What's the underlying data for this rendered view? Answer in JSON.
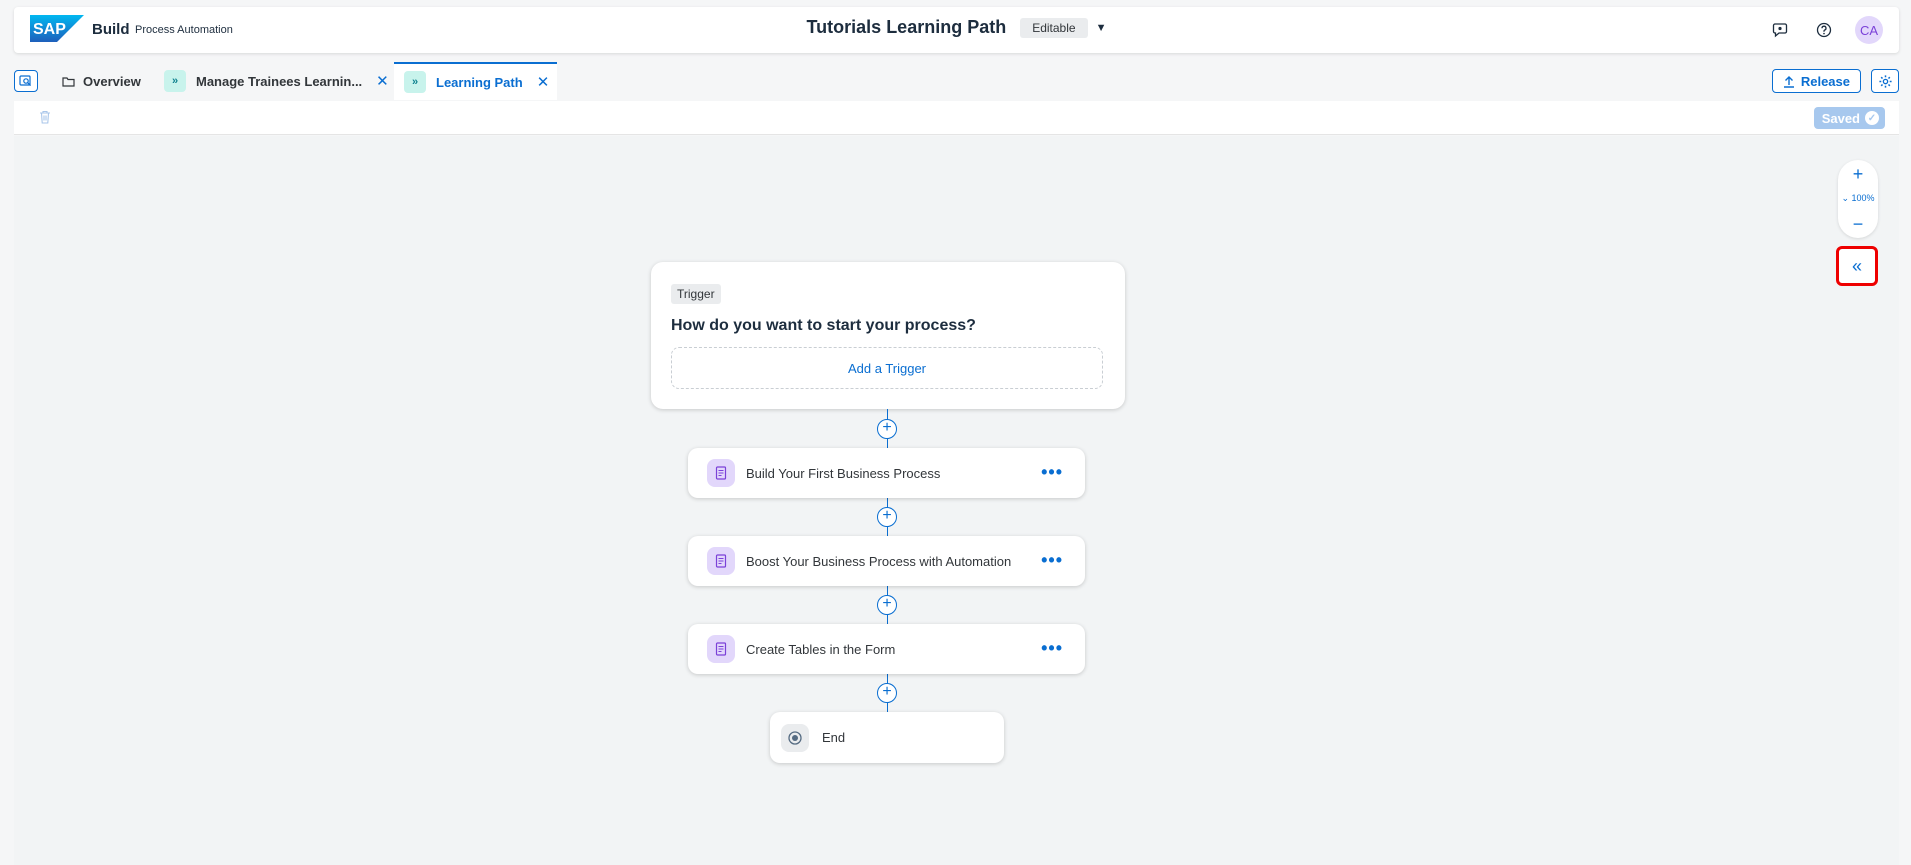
{
  "shell": {
    "logo_text": "SAP",
    "brand": "Build",
    "product": "Process Automation",
    "title": "Tutorials Learning Path",
    "status_tag": "Editable",
    "avatar_initials": "CA"
  },
  "tabs": [
    {
      "label": "Overview",
      "icon": "folder-icon"
    },
    {
      "label": "Manage Trainees Learnin...",
      "icon": "process-icon"
    },
    {
      "label": "Learning Path",
      "icon": "process-icon",
      "active": true
    }
  ],
  "toolbar": {
    "release_label": "Release",
    "saved_label": "Saved"
  },
  "zoom": {
    "plus": "+",
    "level": "100%",
    "minus": "−"
  },
  "trigger": {
    "tag": "Trigger",
    "question": "How do you want to start your process?",
    "add_label": "Add a Trigger"
  },
  "steps": [
    {
      "label": "Build Your First Business Process"
    },
    {
      "label": "Boost Your Business Process with Automation"
    },
    {
      "label": "Create Tables in the Form"
    }
  ],
  "end": {
    "label": "End"
  },
  "colors": {
    "accent": "#0a6ed1",
    "highlight": "#ee0000",
    "step_icon_bg": "#e2d7fb"
  }
}
